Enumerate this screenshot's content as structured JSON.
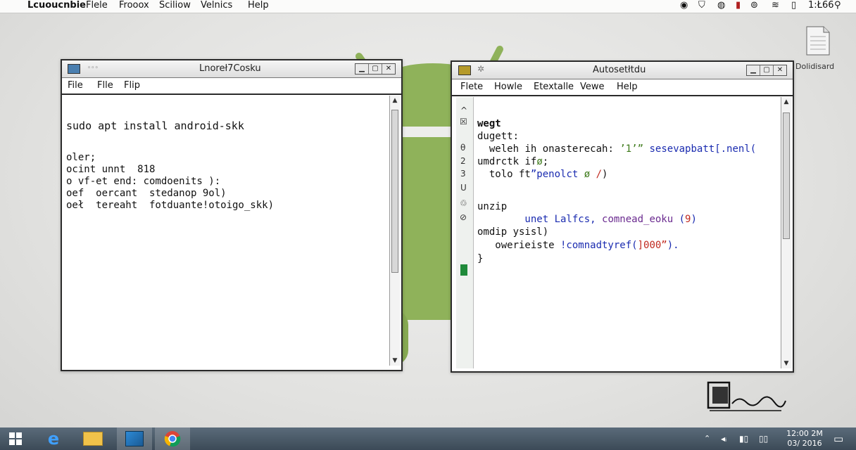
{
  "menubar": {
    "app_name": "Lcuoucnbie",
    "items": [
      "Flele",
      "Frooox",
      "Sciliow",
      "Velnics",
      "Help"
    ],
    "status_text": "1:Ł66"
  },
  "desktop_icon": {
    "label": "Dolidisard"
  },
  "left_window": {
    "title": "Lnoreł7Cosku",
    "menu": [
      "File",
      "Flle",
      "Flip"
    ],
    "lines": [
      "sudo apt install android-skk",
      "",
      "",
      "oler;",
      "ocint unnt  818",
      "o vf-et end: comdoenits ):",
      "oef  oercant  stedanop 9ol)",
      "oeł  tereaht  fotduante!otoigo_skk)"
    ]
  },
  "right_window": {
    "title": "Autosetłtdu",
    "menu": [
      "Flete",
      "Howle",
      "Etextalle",
      "Vewe",
      "Help"
    ],
    "gutter": [
      "^",
      "☒",
      "θ",
      "2",
      "3",
      "U",
      "",
      "♲",
      "⊘"
    ],
    "code": {
      "l1": "wegt",
      "l2": "dugett:",
      "l3a": "  weleh",
      "l3b": " ih ",
      "l3c": "onasterecah:",
      "l3d": " ’1’”",
      "l3e": " sesevapbatt",
      "l3f": "[.nenl(",
      "l4a": "umdrctk",
      "l4b": " if",
      "l4c": "ø",
      "l4d": ";",
      "l5a": "  tolo",
      "l5b": " ft",
      "l5c": "”penolct",
      "l5d": " ø",
      "l5e": " /",
      "l5f": ")",
      "l6": "unzip",
      "l7a": "        unet ",
      "l7b": "Lalfcs, ",
      "l7c": "comnead_eoku",
      "l7d": " (",
      "l7e": "9",
      "l7f": ")",
      "l8": "omdip ",
      "l8b": "ysisl)",
      "l9a": "   owerieiste",
      "l9b": " !comnadtyref(",
      "l9c": "]000”",
      "l9d": ").",
      "l10": "}"
    }
  },
  "taskbar": {
    "clock_time": "12:00 2M",
    "clock_date": "03/ 2016"
  },
  "colors": {
    "keyword_blue": "#1a2bb0",
    "keyword_green": "#3d7a1a",
    "accent_red": "#c0281e",
    "accent_purple": "#6a2a8f",
    "android_green": "#8fb25a"
  }
}
